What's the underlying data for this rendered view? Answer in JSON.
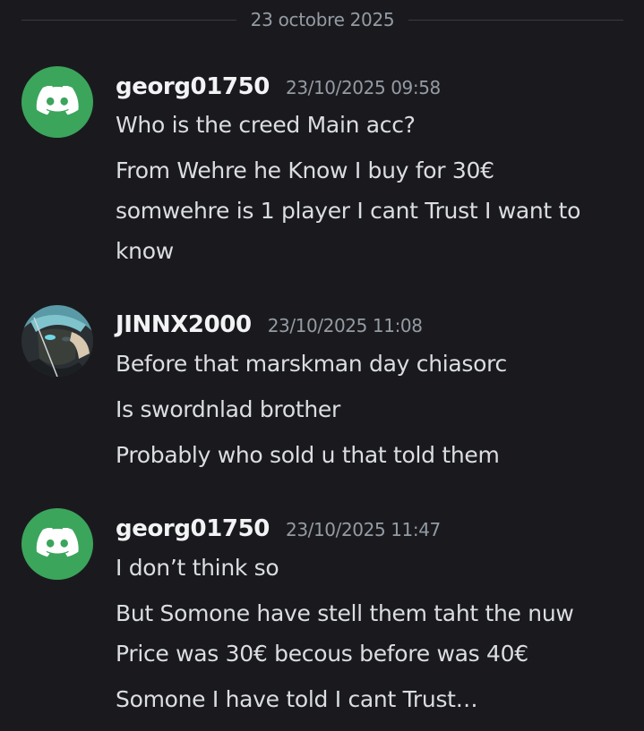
{
  "divider": {
    "date": "23 octobre 2025"
  },
  "messages": [
    {
      "username": "georg01750",
      "timestamp": "23/10/2025 09:58",
      "avatar": "discord-logo-icon",
      "lines": [
        "Who is the creed Main acc?",
        "From Wehre he Know I buy for 30€",
        "somwehre is 1 player I cant Trust I want to know"
      ]
    },
    {
      "username": "JINNX2000",
      "timestamp": "23/10/2025 11:08",
      "avatar": "anime-character-avatar",
      "lines": [
        "Before that marskman day chiasorc",
        "Is swordnlad brother",
        "Probably who sold u that told them"
      ]
    },
    {
      "username": "georg01750",
      "timestamp": "23/10/2025 11:47",
      "avatar": "discord-logo-icon",
      "lines": [
        "I don’t think so",
        "But Somone have stell them taht the nuw Price was 30€ becous before was 40€",
        "Somone I have told I cant Trust…"
      ]
    }
  ],
  "colors": {
    "background": "#1a1a1e",
    "discord_green": "#3ba55c",
    "username": "#f2f3f5",
    "text": "#dbdee1",
    "muted": "#949ba4"
  }
}
